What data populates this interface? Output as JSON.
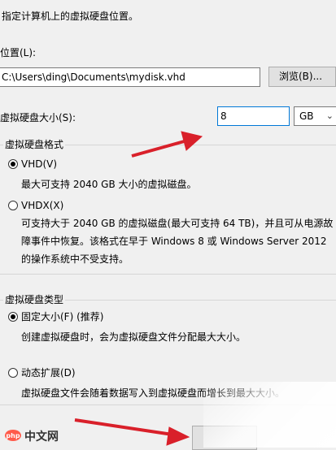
{
  "header": {
    "instruction": "指定计算机上的虚拟硬盘位置。"
  },
  "location": {
    "label": "位置(L):",
    "path_value": "C:\\Users\\ding\\Documents\\mydisk.vhd",
    "browse_label": "浏览(B)..."
  },
  "size": {
    "label": "虚拟硬盘大小(S):",
    "value": "8",
    "unit": "GB"
  },
  "format_group": {
    "title": "虚拟硬盘格式",
    "vhd_label": "VHD(V)",
    "vhd_selected": true,
    "vhd_desc": "最大可支持 2040 GB 大小的虚拟磁盘。",
    "vhdx_label": "VHDX(X)",
    "vhdx_selected": false,
    "vhdx_desc": "可支持大于 2040 GB 的虚拟磁盘(最大可支持 64 TB)，并且可从电源故障事件中恢复。该格式在早于 Windows 8 或 Windows Server 2012 的操作系统中不受支持。"
  },
  "type_group": {
    "title": "虚拟硬盘类型",
    "fixed_label": "固定大小(F) (推荐)",
    "fixed_selected": true,
    "fixed_desc": "创建虚拟硬盘时，会为虚拟硬盘文件分配最大大小。",
    "dynamic_label": "动态扩展(D)",
    "dynamic_selected": false,
    "dynamic_desc": "虚拟硬盘文件会随着数据写入到虚拟硬盘而增长到最大大小。"
  },
  "watermark": {
    "text": "中文网"
  },
  "colors": {
    "arrow": "#d9202a",
    "focus_border": "#0078d7"
  },
  "icons": {
    "dropdown": "chevron-down-icon",
    "annotation": "red-arrow-annotation"
  }
}
